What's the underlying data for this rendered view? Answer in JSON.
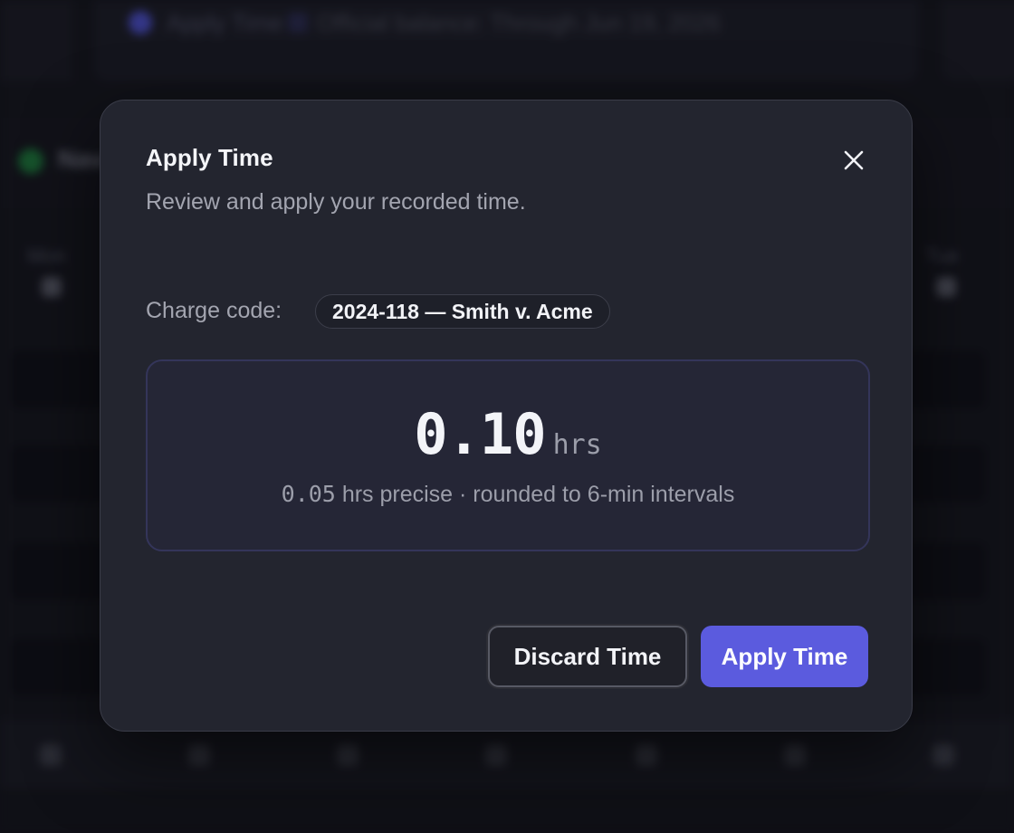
{
  "background": {
    "topbar_label": "Apply Time",
    "topbar_detail": "Official balance: Through Jun 19, 2026",
    "section_label": "Nav",
    "column_left_head": "Mon",
    "column_right_head": "Tue"
  },
  "modal": {
    "title": "Apply Time",
    "subtitle": "Review and apply your recorded time.",
    "close_icon": "close-icon",
    "charge": {
      "label": "Charge code:",
      "value": "2024-118 — Smith v. Acme"
    },
    "time": {
      "value": "0.10",
      "unit": "hrs",
      "precise_value": "0.05",
      "precise_note": "hrs precise · rounded to 6-min intervals"
    },
    "buttons": {
      "discard_label": "Discard Time",
      "apply_label": "Apply Time"
    }
  },
  "colors": {
    "accent": "#5b5bde",
    "modal_bg": "#23252f",
    "page_bg": "#14151c"
  }
}
